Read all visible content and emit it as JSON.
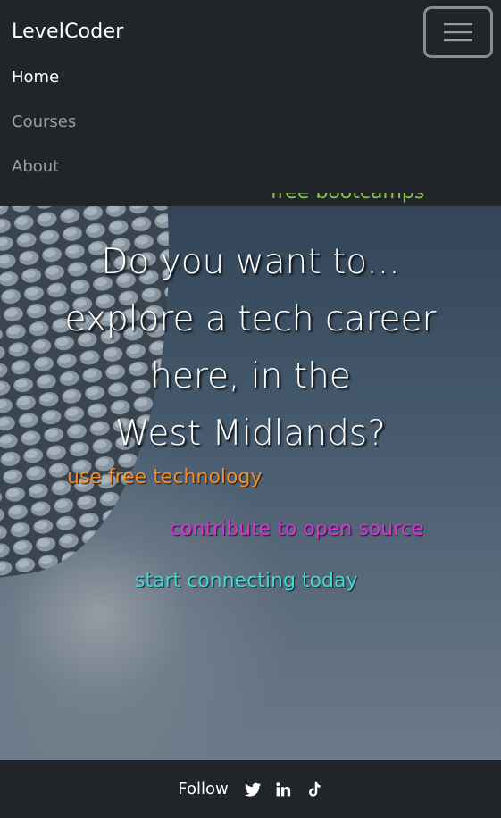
{
  "navbar": {
    "brand": "LevelCoder",
    "toggler_icon": "hamburger-menu-icon",
    "links": [
      {
        "label": "Home",
        "active": true
      },
      {
        "label": "Courses",
        "active": false
      },
      {
        "label": "About",
        "active": false
      }
    ]
  },
  "hero": {
    "partially_visible_text": "free bootcamps",
    "headline_lines": [
      "Do you want to...",
      "explore a tech career",
      "here, in the",
      "West Midlands?"
    ],
    "taglines": [
      {
        "text": "use free technology",
        "color": "#f28c28"
      },
      {
        "text": "contribute to open source",
        "color": "#d633d6"
      },
      {
        "text": "start connecting today",
        "color": "#3fd9d9"
      }
    ]
  },
  "footer": {
    "follow_label": "Follow",
    "social_icons": [
      "twitter-icon",
      "linkedin-icon",
      "tiktok-icon"
    ]
  },
  "colors": {
    "navbar_bg": "#212529",
    "peek_text": "#8bc34a",
    "link_muted": "rgba(255,255,255,0.55)"
  }
}
